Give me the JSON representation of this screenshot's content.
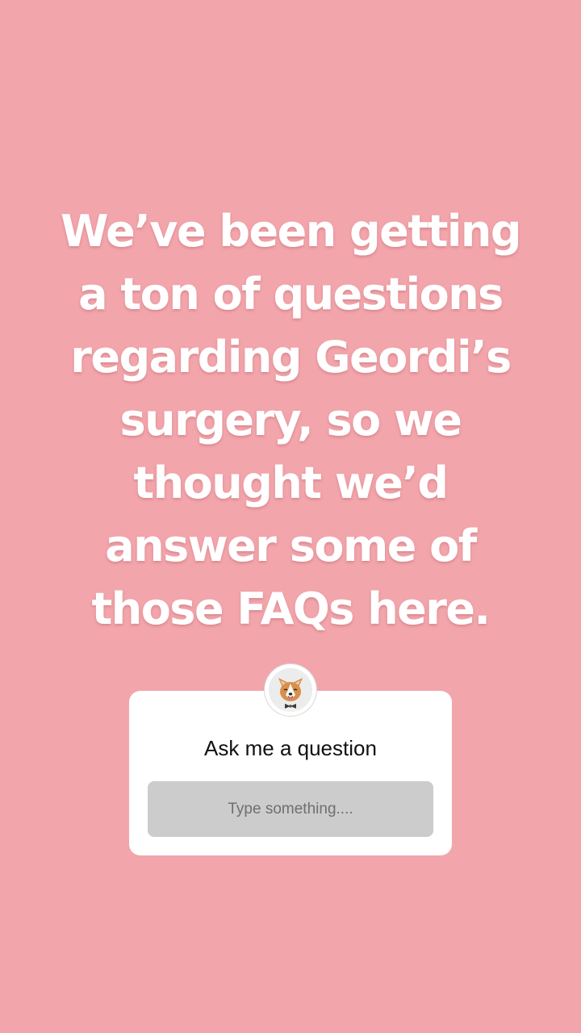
{
  "story": {
    "lines": [
      "We’ve been getting",
      "a ton of questions",
      "regarding Geordi’s",
      "surgery, so we",
      "thought we’d",
      "answer some of",
      "those FAQs here."
    ],
    "background_color": "#f2a5ab",
    "text_color": "#ffffff"
  },
  "question_sticker": {
    "title": "Ask me a question",
    "placeholder": "Type something....",
    "avatar_icon": "corgi-avatar-icon"
  }
}
